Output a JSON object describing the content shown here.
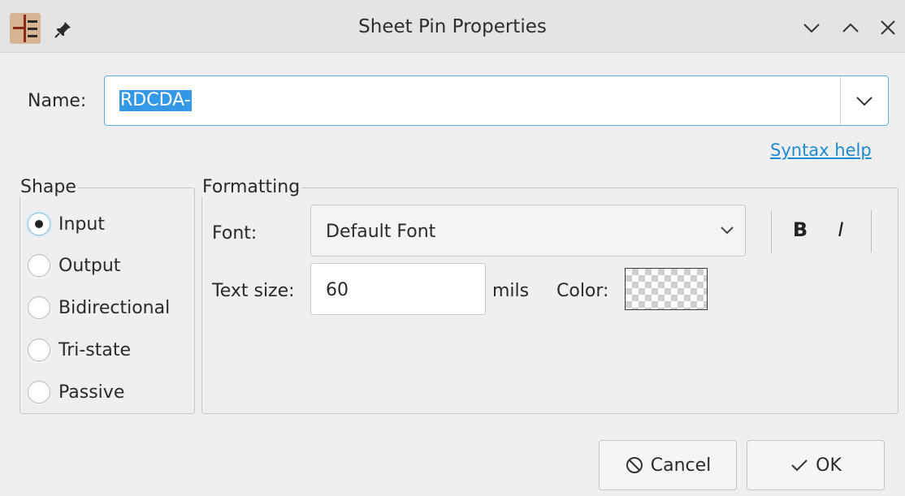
{
  "window": {
    "title": "Sheet Pin Properties"
  },
  "name_field": {
    "label": "Name:",
    "value": "RDCDA-"
  },
  "syntax_help": "Syntax help",
  "shape": {
    "legend": "Shape",
    "options": [
      {
        "label": "Input",
        "checked": true
      },
      {
        "label": "Output",
        "checked": false
      },
      {
        "label": "Bidirectional",
        "checked": false
      },
      {
        "label": "Tri-state",
        "checked": false
      },
      {
        "label": "Passive",
        "checked": false
      }
    ]
  },
  "formatting": {
    "legend": "Formatting",
    "font_label": "Font:",
    "font_value": "Default Font",
    "bold": "B",
    "italic": "I",
    "text_size_label": "Text size:",
    "text_size_value": "60",
    "units": "mils",
    "color_label": "Color:"
  },
  "buttons": {
    "cancel": "Cancel",
    "ok": "OK"
  },
  "colors": {
    "accent": "#3399e6",
    "link": "#1d8bd1"
  }
}
